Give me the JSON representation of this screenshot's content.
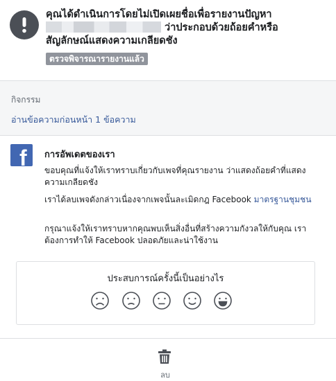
{
  "report": {
    "line1": "คุณได้ดำเนินการโดยไม่เปิดเผยชื่อเพื่อรายงานปัญหา",
    "line2_suffix": " ว่าประกอบด้วยถ้อยคำหรือ",
    "line3": "สัญลักษณ์แสดงความเกลียดชัง",
    "status_badge": "ตรวจพิจารณารายงานแล้ว",
    "icon": "exclamation-icon"
  },
  "activity": {
    "title": "กิจกรรม",
    "link": "อ่านข้อความก่อนหน้า 1 ข้อความ"
  },
  "update": {
    "logo": "f",
    "title": "การอัพเดตของเรา",
    "p1": "ขอบคุณที่แจ้งให้เราทราบเกี่ยวกับเพจที่คุณรายงาน ว่าแสดงถ้อยคำที่แสดงความเกลียดชัง",
    "p2_text": "เราได้ลบเพจดังกล่าวเนื่องจากเพจนั้นละเมิดกฎ Facebook ",
    "p2_link": "มาตรฐานชุมชน",
    "p3": "กรุณาแจ้งให้เราทราบหากคุณพบเห็นสิ่งอื่นที่สร้างความกังวลให้กับคุณ เราต้องการทำให้ Facebook ปลอดภัยและน่าใช้งาน"
  },
  "feedback": {
    "question": "ประสบการณ์ครั้งนี้เป็นอย่างไร",
    "options": [
      "very-sad-face-icon",
      "sad-face-icon",
      "neutral-face-icon",
      "happy-face-icon",
      "very-happy-face-icon"
    ]
  },
  "footer": {
    "delete_label": "ลบ",
    "icon": "trash-icon"
  },
  "colors": {
    "link": "#365899",
    "facebook_blue": "#4267b2",
    "badge_gray": "#90949c",
    "icon_gray": "#4b4f56"
  }
}
